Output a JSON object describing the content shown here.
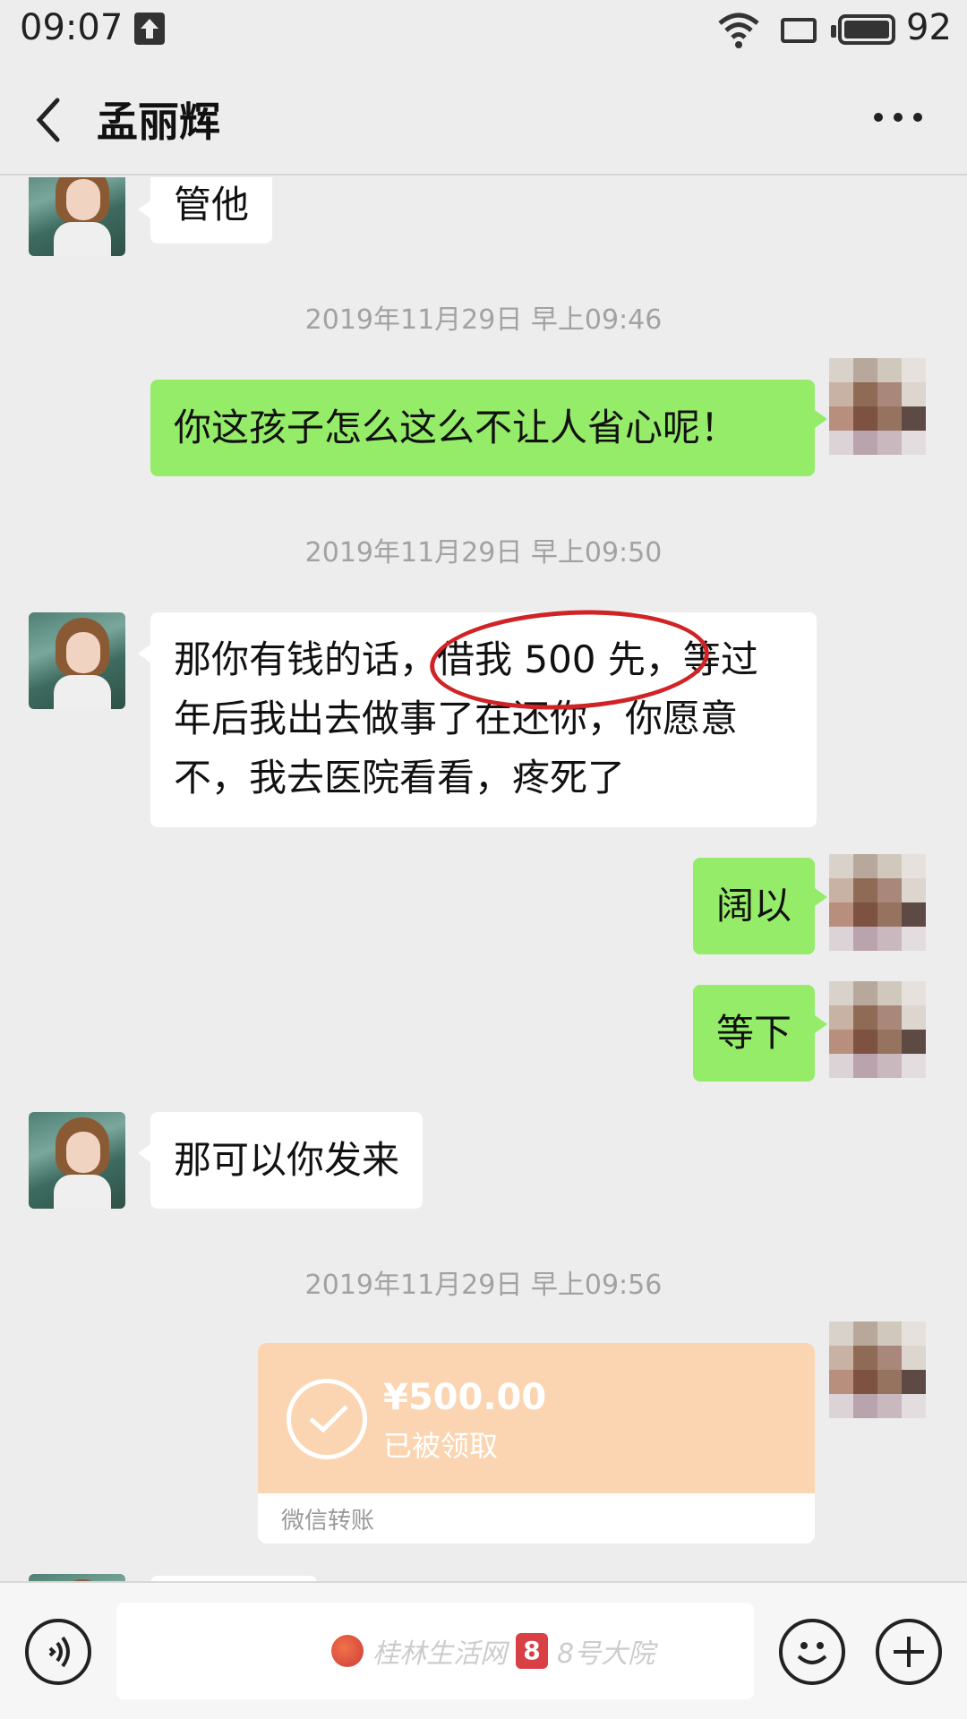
{
  "status_bar": {
    "time": "09:07",
    "battery_level": "92",
    "icons": [
      "upload-icon",
      "wifi-icon",
      "screen-icon",
      "battery-icon"
    ]
  },
  "header": {
    "title": "孟丽辉",
    "back_icon": "chevron-left-icon",
    "more_icon": "more-dots-icon"
  },
  "messages": [
    {
      "type": "in",
      "text": "管他"
    },
    {
      "type": "time",
      "text": "2019年11月29日 早上09:46"
    },
    {
      "type": "out",
      "text": "你这孩子怎么这么不让人省心呢！"
    },
    {
      "type": "time",
      "text": "2019年11月29日 早上09:50"
    },
    {
      "type": "in",
      "lines": [
        "那你有钱的话，借我 500 先，等过",
        "年后我出去做事了在还你，你愿意",
        "不，我去医院看看，疼死了"
      ],
      "highlight": "借我 500 先，"
    },
    {
      "type": "out",
      "text": "阔以"
    },
    {
      "type": "out",
      "text": "等下"
    },
    {
      "type": "in",
      "text": "那可以你发来"
    },
    {
      "type": "time",
      "text": "2019年11月29日 早上09:56"
    },
    {
      "type": "transfer",
      "amount": "¥500.00",
      "status": "已被领取",
      "label": "微信转账"
    }
  ],
  "input_bar": {
    "voice_icon": "voice-icon",
    "emoji_icon": "emoji-icon",
    "plus_icon": "plus-icon",
    "watermark_1": "桂林生活网",
    "watermark_badge": "8",
    "watermark_2": "8号大院"
  },
  "colors": {
    "background": "#ededed",
    "outgoing_bubble": "#95ec69",
    "incoming_bubble": "#ffffff",
    "transfer_card": "#fbd5b1",
    "highlight_ring": "#d02326"
  }
}
